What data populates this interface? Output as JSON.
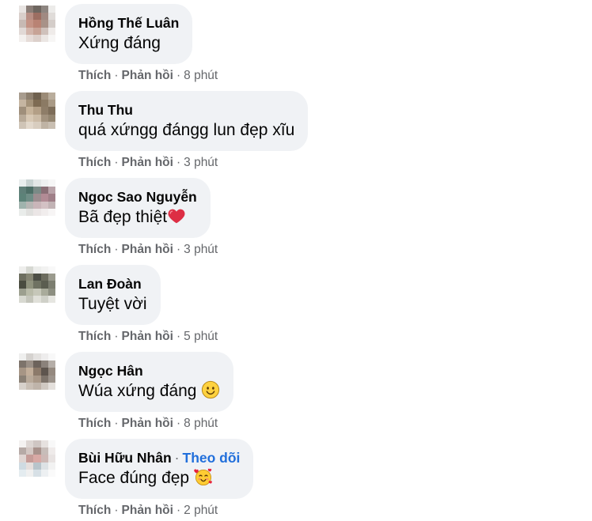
{
  "actions": {
    "like": "Thích",
    "reply": "Phản hồi",
    "separator": "·"
  },
  "colors": {
    "bubble_background": "#f0f2f5",
    "action_text": "#65676b",
    "follow_link": "#216fdb",
    "primary_text": "#050505"
  },
  "comments": [
    {
      "author": "Hồng Thế Luân",
      "text": "Xứng đáng",
      "time": "8 phút",
      "avatar_pixels": [
        [
          "#e8e4e2",
          "#8a7e78",
          "#6e6660",
          "#8d8580",
          "#ecebe9"
        ],
        [
          "#d9cfcb",
          "#b88f85",
          "#9c6e62",
          "#a08a82",
          "#e0dcd9"
        ],
        [
          "#c7b9b3",
          "#c49385",
          "#b98374",
          "#a89288",
          "#d4cdc9"
        ],
        [
          "#e1d9d6",
          "#d2b5ab",
          "#c7a396",
          "#cfc1bb",
          "#efebe9"
        ],
        [
          "#f3f0ee",
          "#e6dcd8",
          "#dcd0cb",
          "#ebe6e3",
          "#f7f6f5"
        ]
      ]
    },
    {
      "author": "Thu Thu",
      "text": "quá xứngg đángg lun đẹp xĩu",
      "time": "3 phút",
      "avatar_pixels": [
        [
          "#a89c8e",
          "#8d7f6e",
          "#6f614f",
          "#9b8b77",
          "#b9ad9c"
        ],
        [
          "#c5b5a1",
          "#a39178",
          "#7e6b53",
          "#8b7a64",
          "#a99a86"
        ],
        [
          "#9f8f7b",
          "#c6b39a",
          "#b39f86",
          "#8e7d68",
          "#7d6d59"
        ],
        [
          "#b8aa98",
          "#d7c8b4",
          "#cbbba6",
          "#a2927e",
          "#938570"
        ],
        [
          "#cfc4b6",
          "#e2d8cb",
          "#d8cdbf",
          "#bfb3a4",
          "#c9bfb2"
        ]
      ]
    },
    {
      "author": "Ngoc Sao Nguyễn",
      "text": "Bã đẹp thiệt",
      "emoji": "red-heart",
      "time": "3 phút",
      "avatar_pixels": [
        [
          "#e9eeee",
          "#c9d3d2",
          "#e3e6e6",
          "#eef0f0",
          "#f6f6f6"
        ],
        [
          "#5f7f78",
          "#4d6e66",
          "#7a8a86",
          "#8a6f76",
          "#b9a3a9"
        ],
        [
          "#5c8278",
          "#6f8d86",
          "#9c8d90",
          "#b28b95",
          "#9f7f88"
        ],
        [
          "#9fb3ad",
          "#b7b6b4",
          "#c9b5b9",
          "#d3c1c4",
          "#c2b3b5"
        ],
        [
          "#e9ecea",
          "#e0e0de",
          "#ebe6e6",
          "#f1eded",
          "#f7f5f5"
        ]
      ]
    },
    {
      "author": "Lan Đoàn",
      "text": "Tuyệt vời",
      "time": "5 phút",
      "avatar_pixels": [
        [
          "#eeeeec",
          "#d6d8d2",
          "#ecedeb",
          "#f2f2f1",
          "#f8f8f8"
        ],
        [
          "#6d6e5f",
          "#858573",
          "#4c4e45",
          "#6c6c5e",
          "#9a9a8d"
        ],
        [
          "#4a4c40",
          "#8f927d",
          "#6f7262",
          "#5b5d50",
          "#7c7e70"
        ],
        [
          "#9c9f8f",
          "#b9bba9",
          "#c6c7b9",
          "#a9ab9b",
          "#8d8f81"
        ],
        [
          "#d8d9d1",
          "#c4c5bb",
          "#e0e0d9",
          "#cfd0c8",
          "#e6e6e1"
        ]
      ]
    },
    {
      "author": "Ngọc Hân",
      "text": "Wúa xứng đáng ",
      "emoji": "slightly-smiling-face",
      "time": "8 phút",
      "avatar_pixels": [
        [
          "#efefee",
          "#d5d2cf",
          "#e4e2e0",
          "#eeeded",
          "#f8f8f8"
        ],
        [
          "#7d736b",
          "#9a8f86",
          "#6d635c",
          "#8b827b",
          "#b5aea8"
        ],
        [
          "#a69585",
          "#c2ae9a",
          "#8c7a6a",
          "#5e554e",
          "#94897f"
        ],
        [
          "#8a8075",
          "#b8a999",
          "#a99888",
          "#7e746b",
          "#9c938b"
        ],
        [
          "#d7d1cb",
          "#c9bfb5",
          "#bfb4aa",
          "#d0c9c2",
          "#e4e0dc"
        ]
      ]
    },
    {
      "author": "Bùi Hữu Nhân",
      "follow_label": "Theo dõi",
      "text": "Face đúng đẹp ",
      "emoji": "smiling-face-with-hearts",
      "time": "2 phút",
      "avatar_pixels": [
        [
          "#f4f2f1",
          "#ddd6d3",
          "#cfc6c3",
          "#e6e1df",
          "#f8f8f8"
        ],
        [
          "#b6aaa6",
          "#d3c7c3",
          "#a8928c",
          "#c7bdb9",
          "#efebea"
        ],
        [
          "#e0d5d2",
          "#c59c98",
          "#d8a9a5",
          "#cdb9b6",
          "#e8e3e2"
        ],
        [
          "#cfdbe2",
          "#e6dfdd",
          "#b8c4cb",
          "#dde2e5",
          "#f2f2f2"
        ],
        [
          "#e4ecf0",
          "#f0f0f0",
          "#d7e0e6",
          "#edf0f2",
          "#fafafa"
        ]
      ]
    }
  ]
}
